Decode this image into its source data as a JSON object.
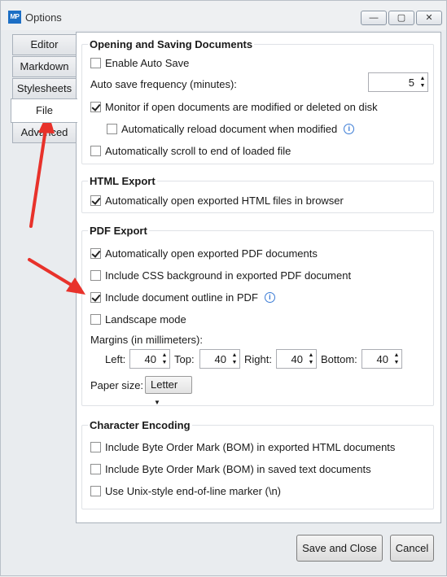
{
  "window": {
    "app_icon_text": "MP",
    "title": "Options",
    "min_glyph": "—",
    "max_glyph": "▢",
    "close_glyph": "✕"
  },
  "tabs": [
    {
      "label": "Editor"
    },
    {
      "label": "Markdown"
    },
    {
      "label": "Stylesheets"
    },
    {
      "label": "File"
    },
    {
      "label": "Advanced"
    }
  ],
  "opening": {
    "title": "Opening and Saving Documents",
    "enable_auto_save": {
      "label": "Enable Auto Save",
      "checked": false
    },
    "auto_save_freq_label": "Auto save frequency (minutes):",
    "auto_save_freq_value": "5",
    "monitor": {
      "label": "Monitor if open documents are modified or deleted on disk",
      "checked": true
    },
    "auto_reload": {
      "label": "Automatically reload document when modified",
      "checked": false
    },
    "auto_scroll": {
      "label": "Automatically scroll to end of loaded file",
      "checked": false
    }
  },
  "html_export": {
    "title": "HTML Export",
    "auto_open": {
      "label": "Automatically open exported HTML files in browser",
      "checked": true
    }
  },
  "pdf_export": {
    "title": "PDF Export",
    "auto_open": {
      "label": "Automatically open exported PDF documents",
      "checked": true
    },
    "css_bg": {
      "label": "Include CSS background in exported PDF document",
      "checked": false
    },
    "outline": {
      "label": "Include document outline in PDF",
      "checked": true
    },
    "landscape": {
      "label": "Landscape mode",
      "checked": false
    },
    "margins_label": "Margins (in millimeters):",
    "left_label": "Left:",
    "left_value": "40",
    "top_label": "Top:",
    "top_value": "40",
    "right_label": "Right:",
    "right_value": "40",
    "bottom_label": "Bottom:",
    "bottom_value": "40",
    "paper_size_label": "Paper size:",
    "paper_size_value": "Letter"
  },
  "encoding": {
    "title": "Character Encoding",
    "bom_html": {
      "label": "Include Byte Order Mark (BOM) in exported HTML documents",
      "checked": false
    },
    "bom_text": {
      "label": "Include Byte Order Mark (BOM) in saved text documents",
      "checked": false
    },
    "unix_eol": {
      "label": "Use Unix-style end-of-line marker (\\n)",
      "checked": false
    }
  },
  "buttons": {
    "save_close": "Save and Close",
    "cancel": "Cancel"
  },
  "info_glyph": "i",
  "colors": {
    "annotation_arrow": "#e8322b",
    "info_icon": "#3a7bd5"
  }
}
